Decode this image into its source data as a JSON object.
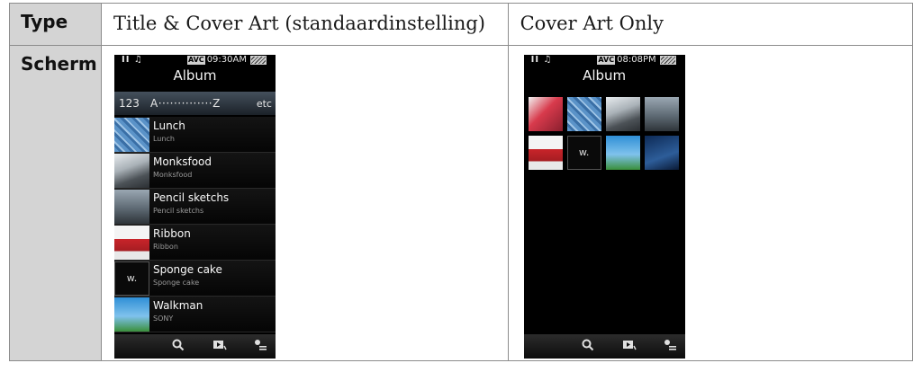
{
  "table": {
    "header_type": "Type",
    "header_screen": "Scherm",
    "col1_title": "Title & Cover Art (standaardinstelling)",
    "col2_title": "Cover Art Only"
  },
  "phone1": {
    "status_time": "09:30AM",
    "status_left": "II ♫",
    "avc": "AVC",
    "title": "Album",
    "alpha_num": "123",
    "alpha_range": "A··············Z",
    "alpha_etc": "etc",
    "rows": [
      {
        "title": "Lunch",
        "sub": "Lunch"
      },
      {
        "title": "Monksfood",
        "sub": "Monksfood"
      },
      {
        "title": "Pencil sketchs",
        "sub": "Pencil sketchs"
      },
      {
        "title": "Ribbon",
        "sub": "Ribbon"
      },
      {
        "title": "Sponge cake",
        "sub": "Sponge cake"
      },
      {
        "title": "Walkman",
        "sub": "SONY"
      }
    ]
  },
  "phone2": {
    "status_time": "08:08PM",
    "status_left": "II ♫",
    "avc": "AVC",
    "title": "Album"
  },
  "icons": {
    "search": "search-icon",
    "now_playing": "now-playing-icon",
    "options": "options-icon"
  }
}
